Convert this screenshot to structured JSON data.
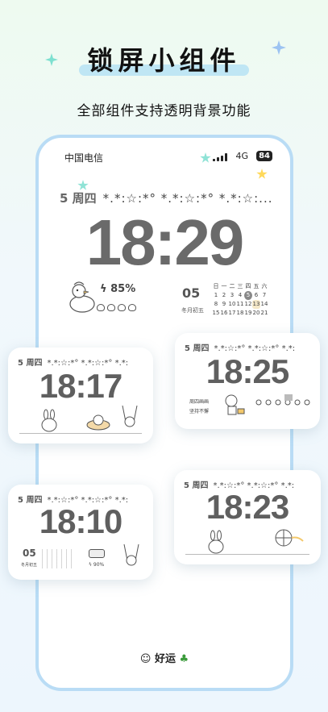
{
  "headline": "锁屏小组件",
  "subhead": "全部组件支持透明背景功能",
  "status": {
    "carrier": "中国电信",
    "network": "4G",
    "battery": "84"
  },
  "main_widget": {
    "date": "5 周四",
    "deco": "*.*:☆:*° *.*:☆:*° *.*:☆:...",
    "time": "18:29",
    "battery_pct": "85%",
    "day_number": "05",
    "lunar": "冬月初五",
    "calendar_header": [
      "日",
      "一",
      "二",
      "三",
      "四",
      "五",
      "六"
    ],
    "calendar_rows": [
      [
        "1",
        "2",
        "3",
        "4",
        "5",
        "6",
        "7"
      ],
      [
        "8",
        "9",
        "10",
        "11",
        "12",
        "13",
        "14"
      ],
      [
        "15",
        "16",
        "17",
        "18",
        "19",
        "20",
        "21"
      ]
    ]
  },
  "cards": [
    {
      "date": "5 周四",
      "deco": "*.*:☆:*° *.*:☆:*° *.*:",
      "time": "18:17"
    },
    {
      "date": "5 周四",
      "deco": "*.*:☆:*° *.*:☆:*° *.*:",
      "time": "18:25",
      "note1": "周四画画",
      "note2": "坚持不懈"
    },
    {
      "date": "5 周四",
      "deco": "*.*:☆:*° *.*:☆:*° *.*:",
      "time": "18:10",
      "day_number": "05",
      "lunar": "冬月初五",
      "battery_pct": "90%"
    },
    {
      "date": "5 周四",
      "deco": "*.*:☆:*° *.*:☆:*° *.*:",
      "time": "18:23"
    }
  ],
  "luck_label": "好运",
  "colors": {
    "frame": "#b9dcf5",
    "time_gray": "#6a6a6a",
    "highlight": "#bfe6f4"
  }
}
